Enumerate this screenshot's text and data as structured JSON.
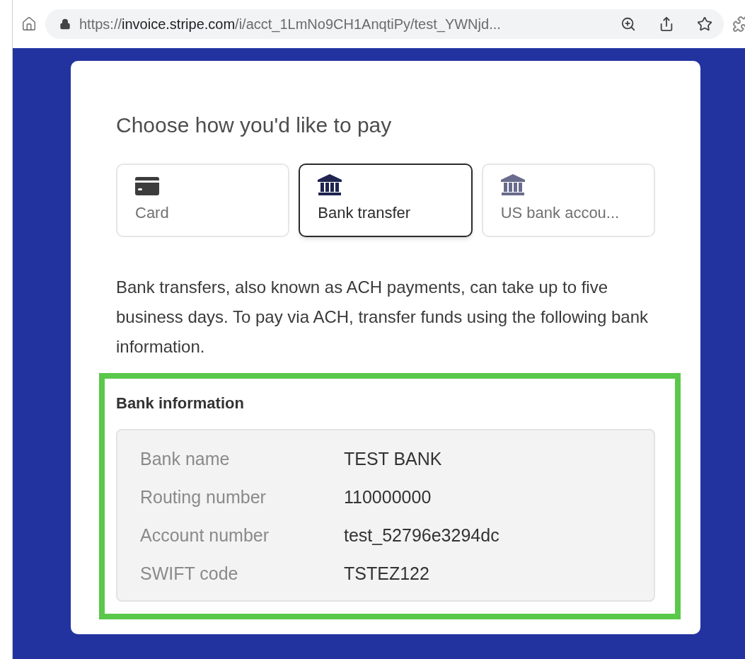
{
  "browser": {
    "url_scheme": "https://",
    "url_host": "invoice.stripe.com",
    "url_path": "/i/acct_1LmNo9CH1AnqtiPy/test_YWNjd..."
  },
  "payment": {
    "title": "Choose how you'd like to pay",
    "methods": [
      {
        "kind": "card",
        "label": "Card",
        "selected": false
      },
      {
        "kind": "bank",
        "label": "Bank transfer",
        "selected": true
      },
      {
        "kind": "bank",
        "label": "US bank accou...",
        "selected": false
      }
    ],
    "description": "Bank transfers, also known as ACH payments, can take up to five business days. To pay via ACH, transfer funds using the following bank information.",
    "bank_info": {
      "heading": "Bank information",
      "rows": [
        {
          "label": "Bank name",
          "value": "TEST BANK"
        },
        {
          "label": "Routing number",
          "value": "110000000"
        },
        {
          "label": "Account number",
          "value": "test_52796e3294dc"
        },
        {
          "label": "SWIFT code",
          "value": "TSTEZ122"
        }
      ]
    }
  }
}
